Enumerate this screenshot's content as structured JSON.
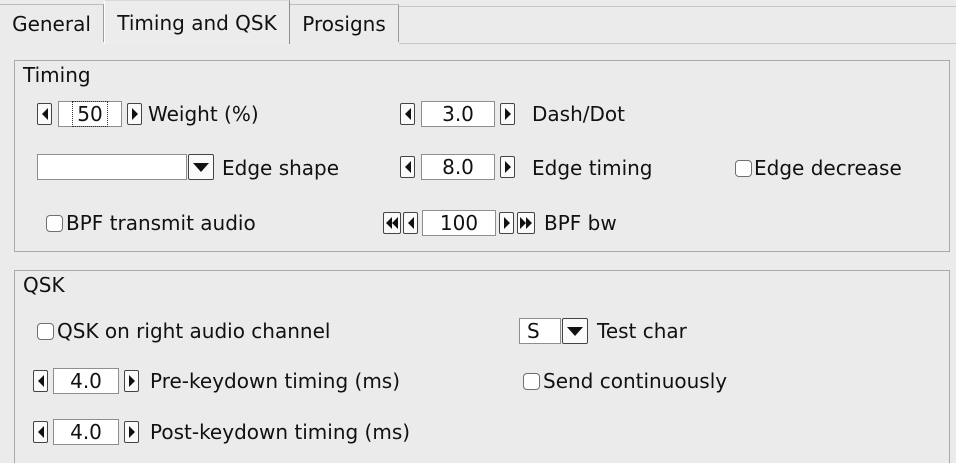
{
  "tabs": [
    {
      "label": "General"
    },
    {
      "label": "Timing and QSK"
    },
    {
      "label": "Prosigns"
    }
  ],
  "timing": {
    "title": "Timing",
    "weight": {
      "value": "50",
      "label": "Weight (%)"
    },
    "dash_dot": {
      "value": "3.0",
      "label": "Dash/Dot"
    },
    "edge_shape": {
      "value": "",
      "label": "Edge shape"
    },
    "edge_timing": {
      "value": "8.0",
      "label": "Edge timing"
    },
    "edge_decrease": {
      "label": "Edge decrease",
      "checked": false
    },
    "bpf_transmit": {
      "label": "BPF transmit audio",
      "checked": false
    },
    "bpf_bw": {
      "value": "100",
      "label": "BPF bw"
    }
  },
  "qsk": {
    "title": "QSK",
    "qsk_right": {
      "label": "QSK on right audio channel",
      "checked": false
    },
    "test_char": {
      "value": "S",
      "label": "Test char"
    },
    "pre_keydown": {
      "value": "4.0",
      "label": "Pre-keydown timing (ms)"
    },
    "send_continuously": {
      "label": "Send continuously",
      "checked": false
    },
    "post_keydown": {
      "value": "4.0",
      "label": "Post-keydown timing (ms)"
    }
  }
}
